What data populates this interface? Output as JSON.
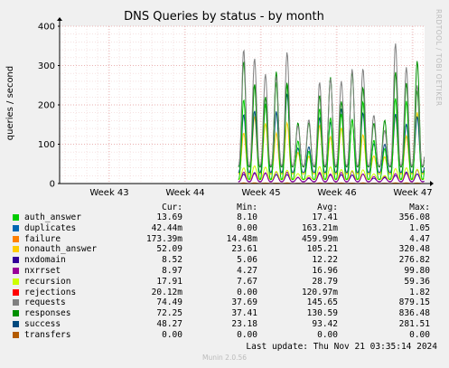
{
  "chart_data": {
    "type": "line",
    "title": "DNS Queries by status - by month",
    "ylabel": "queries / second",
    "xlabel": "",
    "ylim": [
      0,
      400
    ],
    "yticks": [
      0,
      100,
      200,
      300,
      400
    ],
    "xticks": [
      "Week 43",
      "Week 44",
      "Week 45",
      "Week 46",
      "Week 47"
    ],
    "grid": true,
    "data_start_week": 44.7,
    "series": [
      {
        "name": "auth_answer",
        "color": "#00cc00",
        "stats": [
          "13.69",
          "8.10",
          "17.41",
          "356.08"
        ]
      },
      {
        "name": "duplicates",
        "color": "#0066b3",
        "stats": [
          "42.44m",
          "0.00",
          "163.21m",
          "1.05"
        ]
      },
      {
        "name": "failure",
        "color": "#ff8000",
        "stats": [
          "173.39m",
          "14.48m",
          "459.99m",
          "4.47"
        ]
      },
      {
        "name": "nonauth_answer",
        "color": "#ffcc00",
        "stats": [
          "52.09",
          "23.61",
          "105.21",
          "320.48"
        ]
      },
      {
        "name": "nxdomain",
        "color": "#330099",
        "stats": [
          "8.52",
          "5.06",
          "12.22",
          "276.82"
        ]
      },
      {
        "name": "nxrrset",
        "color": "#990099",
        "stats": [
          "8.97",
          "4.27",
          "16.96",
          "99.80"
        ]
      },
      {
        "name": "recursion",
        "color": "#ccff00",
        "stats": [
          "17.91",
          "7.67",
          "28.79",
          "59.36"
        ]
      },
      {
        "name": "rejections",
        "color": "#ff0000",
        "stats": [
          "20.12m",
          "0.00",
          "120.97m",
          "1.82"
        ]
      },
      {
        "name": "requests",
        "color": "#808080",
        "stats": [
          "74.49",
          "37.69",
          "145.65",
          "879.15"
        ]
      },
      {
        "name": "responses",
        "color": "#008f00",
        "stats": [
          "72.25",
          "37.41",
          "130.59",
          "836.48"
        ]
      },
      {
        "name": "success",
        "color": "#00487d",
        "stats": [
          "48.27",
          "23.18",
          "93.42",
          "281.51"
        ]
      },
      {
        "name": "transfers",
        "color": "#b35a00",
        "stats": [
          "0.00",
          "0.00",
          "0.00",
          "0.00"
        ]
      }
    ]
  },
  "legend_headers": {
    "cur": "Cur:",
    "min": "Min:",
    "avg": "Avg:",
    "max": "Max:"
  },
  "last_update": "Last update: Thu Nov 21 03:35:14 2024",
  "watermark": "Munin 2.0.56",
  "side_credit": "RRDTOOL / TOBI OETIKER"
}
